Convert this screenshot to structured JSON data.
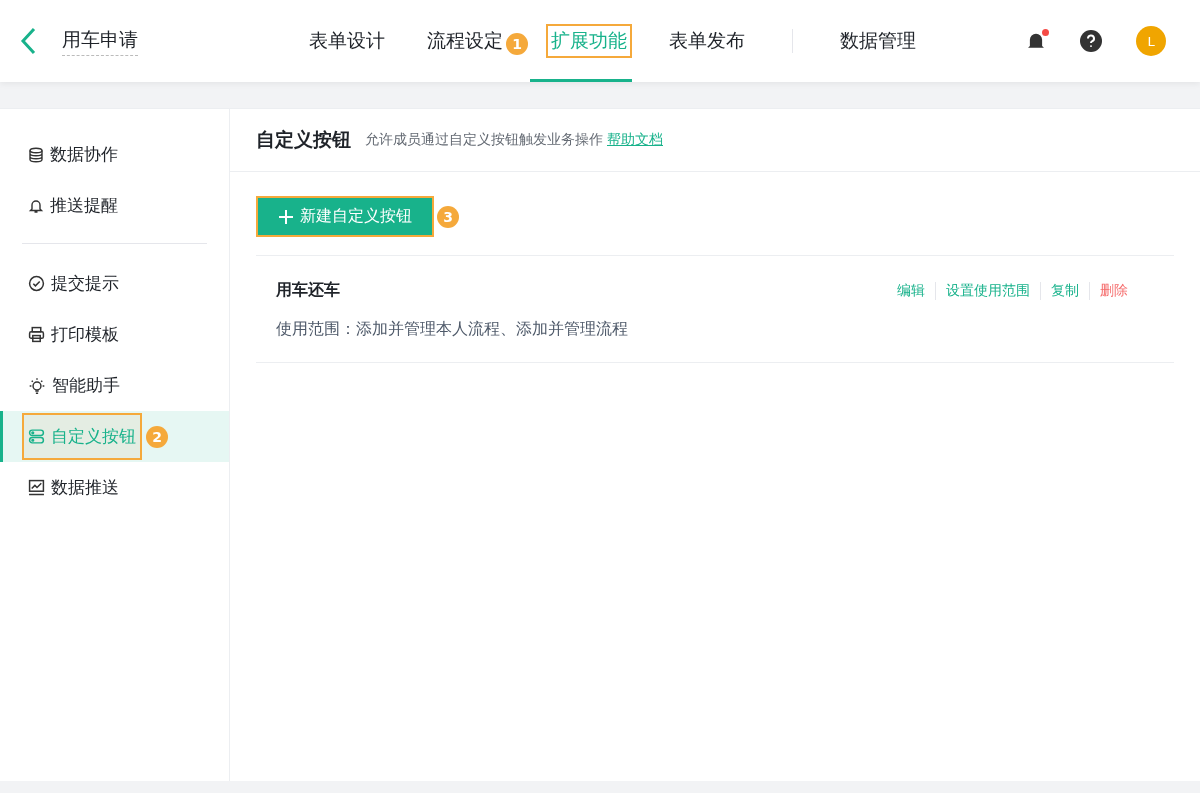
{
  "header": {
    "title": "用车申请",
    "avatar": "L",
    "notification_dot": true,
    "tabs": [
      {
        "label": "表单设计",
        "selected": false,
        "divider_before": false
      },
      {
        "label": "流程设定",
        "selected": false,
        "divider_before": false
      },
      {
        "label": "扩展功能",
        "selected": true,
        "divider_before": false,
        "annotation": "1"
      },
      {
        "label": "表单发布",
        "selected": false,
        "divider_before": false
      },
      {
        "label": "数据管理",
        "selected": false,
        "divider_before": true
      }
    ]
  },
  "sidebar": {
    "groups": [
      {
        "items": [
          {
            "label": "数据协作",
            "selected": false
          },
          {
            "label": "推送提醒",
            "selected": false
          }
        ]
      },
      {
        "items": [
          {
            "label": "提交提示",
            "selected": false
          },
          {
            "label": "打印模板",
            "selected": false
          },
          {
            "label": "智能助手",
            "selected": false
          },
          {
            "label": "自定义按钮",
            "selected": true,
            "annotation": "2"
          },
          {
            "label": "数据推送",
            "selected": false
          }
        ]
      }
    ]
  },
  "content": {
    "title": "自定义按钮",
    "description": "允许成员通过自定义按钮触发业务操作",
    "help_link": "帮助文档",
    "new_button": {
      "label": "新建自定义按钮",
      "annotation": "3"
    },
    "buttons": [
      {
        "name": "用车还车",
        "scope": "使用范围：添加并管理本人流程、添加并管理流程",
        "actions": [
          {
            "label": "编辑",
            "kind": "normal"
          },
          {
            "label": "设置使用范围",
            "kind": "normal"
          },
          {
            "label": "复制",
            "kind": "normal"
          },
          {
            "label": "删除",
            "kind": "danger"
          }
        ]
      }
    ]
  }
}
